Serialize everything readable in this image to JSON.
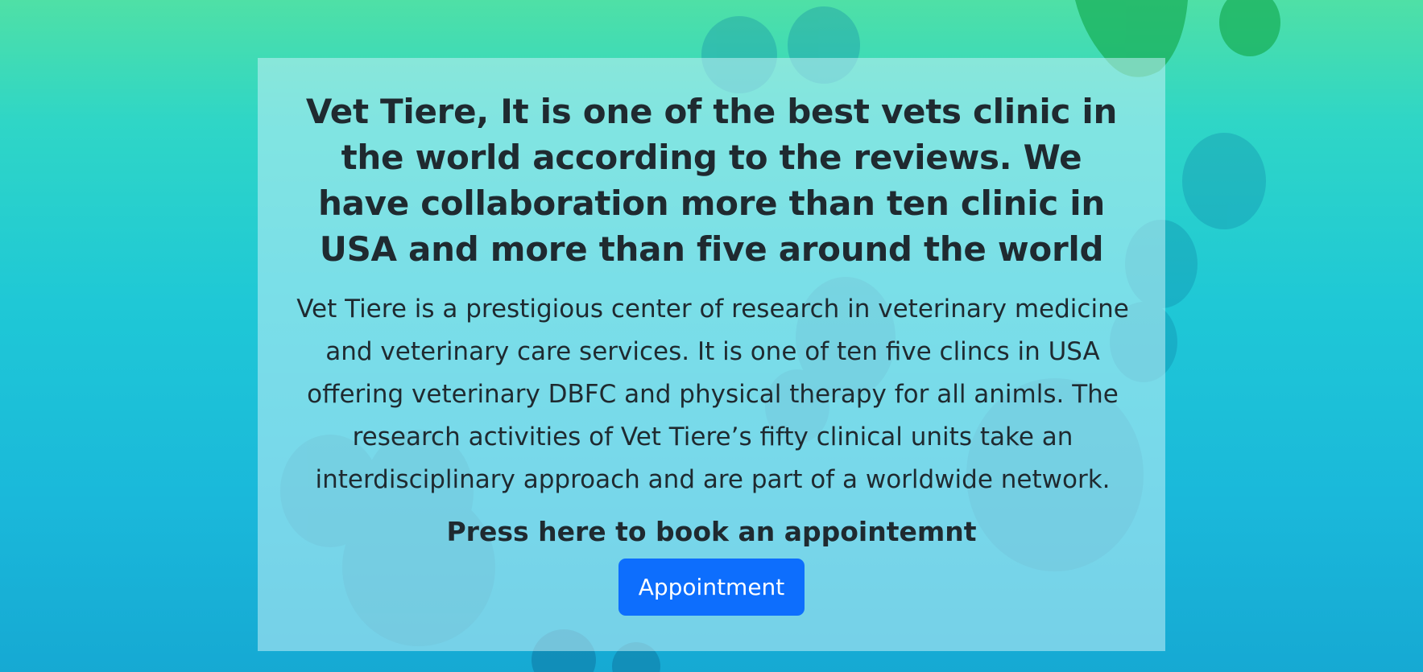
{
  "hero": {
    "heading": "Vet Tiere, It is one of the best vets clinic in the world according to the reviews. We have collaboration more than ten clinic in USA and more than five around the world",
    "body": "Vet Tiere is a prestigious center of research in veterinary medicine and veterinary care services. It is one of ten five clincs in USA offering veterinary DBFC and physical therapy for all animls. The research activities of Vet Tiere’s fifty clinical units take an interdisciplinary approach and are part of a worldwide network.",
    "cta_label": "Press here to book an appointemnt",
    "button_label": "Appointment"
  },
  "colors": {
    "button": "#0d6efd",
    "text": "#1f2a30"
  }
}
